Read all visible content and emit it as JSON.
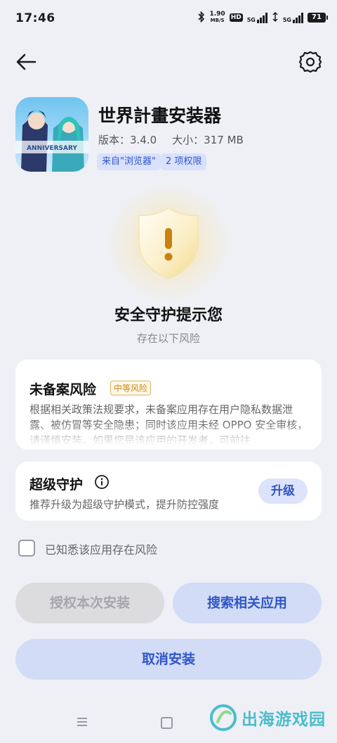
{
  "status_bar": {
    "time": "17:46",
    "net_speed_value": "1.90",
    "net_speed_unit": "MB/S",
    "hd_label": "HD",
    "signal1_label": "5G",
    "signal2_label": "5G",
    "battery": "71"
  },
  "header": {
    "back_icon": "arrow-left-icon",
    "settings_icon": "gear-icon"
  },
  "app": {
    "name": "世界計畫安装器",
    "version_label": "版本：3.4.0",
    "size_label": "大小：317 MB",
    "source_tag": "来自\"浏览器\"",
    "permissions_tag": "2 项权限",
    "icon_text": "ANNIVERSARY"
  },
  "security": {
    "title": "安全守护提示您",
    "subtitle": "存在以下风险",
    "shield_icon": "shield-warning-icon"
  },
  "risk_card": {
    "title": "未备案风险",
    "badge": "中等风险",
    "description": "根据相关政策法规要求，未备案应用存在用户隐私数据泄露、被仿冒等安全隐患；同时该应用未经 OPPO 安全审核，请谨慎安装。如果您是该应用的开发者，可前往"
  },
  "protect_card": {
    "title": "超级守护",
    "description": "推荐升级为超级守护模式，提升防控强度",
    "upgrade_label": "升级",
    "info_icon": "info-icon"
  },
  "consent": {
    "label": "已知悉该应用存在风险",
    "checked": false
  },
  "actions": {
    "authorize_label": "授权本次安装",
    "search_label": "搜索相关应用",
    "cancel_label": "取消安装"
  },
  "watermark": {
    "text": "出海游戏园"
  },
  "colors": {
    "background": "#eef0f6",
    "accent": "#2f56c7",
    "accent_bg": "#d3dcf6",
    "warning": "#c98a14"
  }
}
